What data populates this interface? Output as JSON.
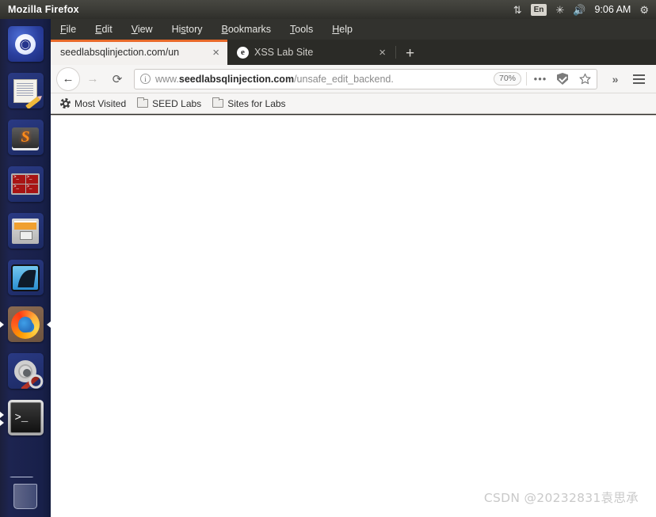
{
  "titlebar": {
    "app_name": "Mozilla Firefox",
    "indicators": {
      "network_icon": "up-down-arrows-icon",
      "keyboard_layout": "En",
      "bluetooth_icon": "bluetooth-icon",
      "volume_icon": "volume-icon",
      "clock": "9:06 AM",
      "system_menu_icon": "gear-icon"
    }
  },
  "menubar": {
    "items": [
      {
        "label": "File",
        "accel": "F"
      },
      {
        "label": "Edit",
        "accel": "E"
      },
      {
        "label": "View",
        "accel": "V"
      },
      {
        "label": "History",
        "accel": "s"
      },
      {
        "label": "Bookmarks",
        "accel": "B"
      },
      {
        "label": "Tools",
        "accel": "T"
      },
      {
        "label": "Help",
        "accel": "H"
      }
    ]
  },
  "tabs": {
    "items": [
      {
        "label": "seedlabsqlinjection.com/un",
        "active": true,
        "favicon": "none",
        "close_label": "×"
      },
      {
        "label": "XSS Lab Site",
        "active": false,
        "favicon": "elgg-e-icon",
        "favicon_letter": "e",
        "close_label": "×"
      }
    ],
    "new_tab_label": "+"
  },
  "navbar": {
    "back_label": "←",
    "forward_label": "→",
    "reload_label": "⟳",
    "url_prefix": "www.",
    "url_host": "seedlabsqlinjection.com",
    "url_path": "/unsafe_edit_backend.",
    "zoom_level": "70%",
    "page_actions_icon": "ellipsis-icon",
    "pocket_icon": "pocket-shield-icon",
    "bookmark_icon": "star-icon",
    "overflow_label": "»",
    "menu_icon": "hamburger-menu-icon",
    "identity_icon": "info-circle-icon"
  },
  "bookmarks": {
    "items": [
      {
        "label": "Most Visited",
        "icon": "gear-icon"
      },
      {
        "label": "SEED Labs",
        "icon": "folder-icon"
      },
      {
        "label": "Sites for Labs",
        "icon": "folder-icon"
      }
    ]
  },
  "launcher": {
    "items": [
      {
        "name": "ubuntu-dash",
        "label": "Ubuntu Dash",
        "running": false,
        "focused": false
      },
      {
        "name": "text-editor",
        "label": "Text Editor",
        "running": false,
        "focused": false
      },
      {
        "name": "sublime-text",
        "label": "Sublime Text",
        "running": false,
        "focused": false
      },
      {
        "name": "terminator",
        "label": "Terminator",
        "running": false,
        "focused": false
      },
      {
        "name": "file-manager",
        "label": "Files",
        "running": false,
        "focused": false
      },
      {
        "name": "wireshark",
        "label": "Wireshark",
        "running": false,
        "focused": false
      },
      {
        "name": "firefox",
        "label": "Firefox",
        "running": true,
        "focused": true
      },
      {
        "name": "settings",
        "label": "System Settings",
        "running": false,
        "focused": false
      },
      {
        "name": "terminal",
        "label": "Terminal",
        "running": true,
        "focused": false
      },
      {
        "name": "trash",
        "label": "Trash",
        "running": false,
        "focused": false
      }
    ]
  },
  "content": {
    "body_text": "",
    "watermark": "CSDN @20232831袁思承"
  },
  "colors": {
    "launcher_bg": "#1c2450",
    "titlebar_bg": "#3c3c37",
    "tabstrip_bg": "#2b2b27",
    "active_tab_accent": "#e86a2a",
    "toolbar_bg": "#f6f5f4",
    "content_bg": "#ffffff",
    "watermark_color": "#c9c9c9"
  }
}
